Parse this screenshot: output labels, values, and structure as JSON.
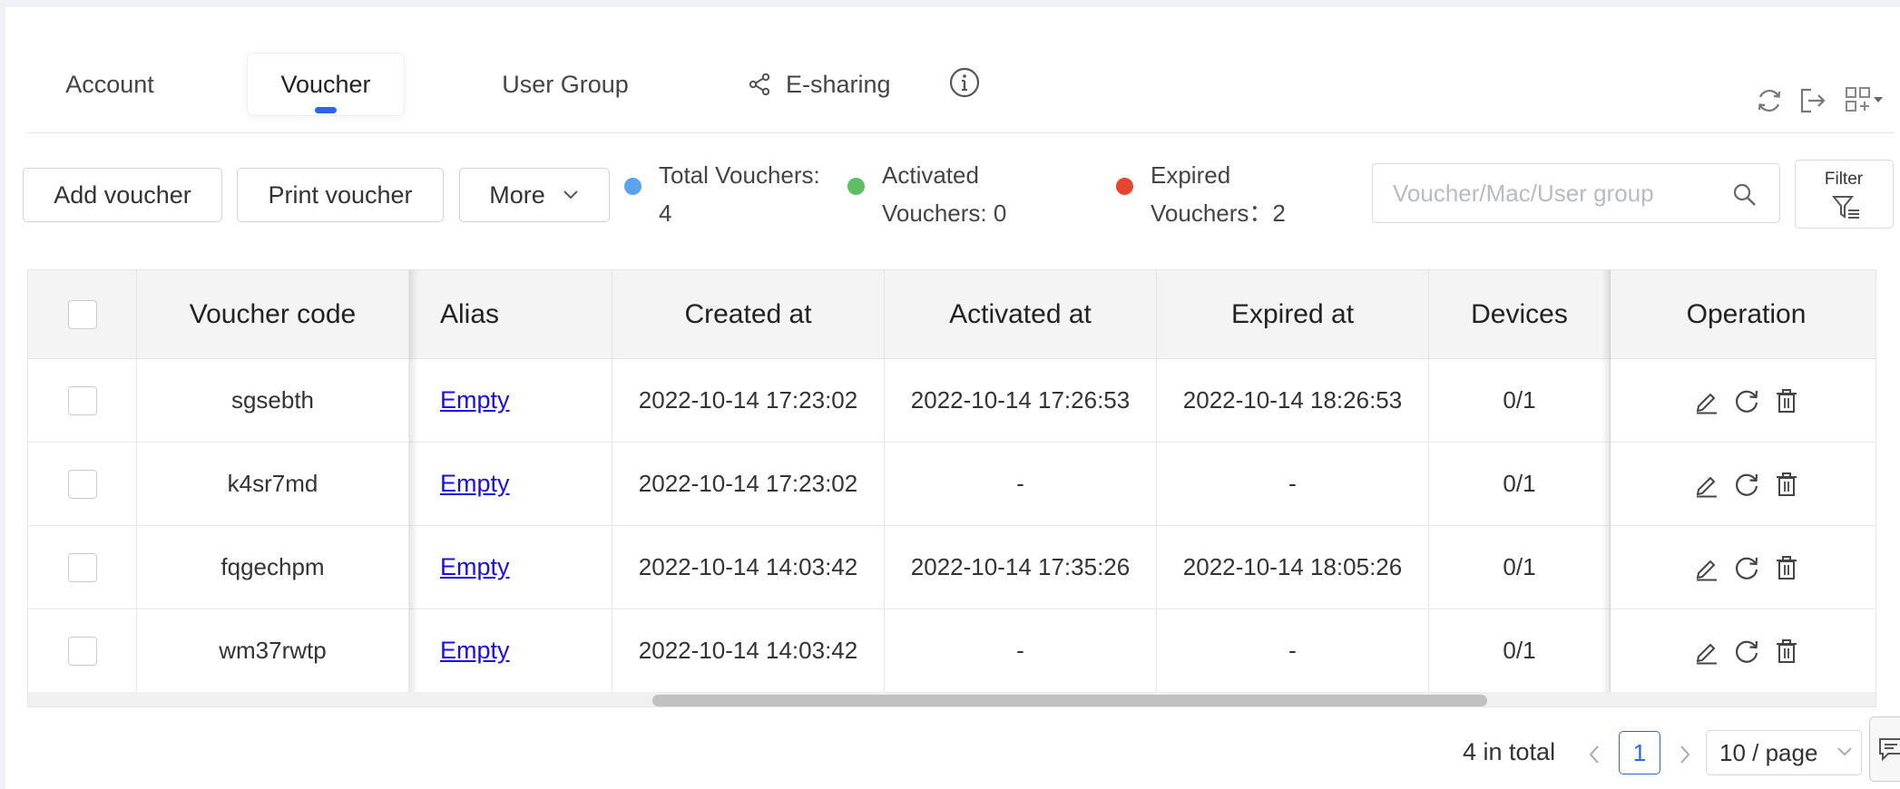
{
  "tabs": [
    {
      "label": "Account"
    },
    {
      "label": "Voucher"
    },
    {
      "label": "User Group"
    },
    {
      "label": "E-sharing"
    }
  ],
  "toolbar": {
    "add_voucher": "Add voucher",
    "print_voucher": "Print voucher",
    "more": "More"
  },
  "stats": {
    "total": {
      "line1": "Total Vouchers:",
      "line2": "4",
      "color": "#5aa3f0"
    },
    "activated": {
      "line1": "Activated",
      "line2": "Vouchers: 0",
      "color": "#5dbf62"
    },
    "expired": {
      "line1": "Expired",
      "line2": "Vouchers：2",
      "color": "#e8442d"
    }
  },
  "search": {
    "placeholder": "Voucher/Mac/User group"
  },
  "filter": {
    "label": "Filter"
  },
  "table": {
    "columns": [
      "Voucher code",
      "Alias",
      "Created at",
      "Activated at",
      "Expired at",
      "Devices",
      "Operation"
    ],
    "rows": [
      {
        "code": "sgsebth",
        "alias": "Empty",
        "created": "2022-10-14 17:23:02",
        "activated": "2022-10-14 17:26:53",
        "expired": "2022-10-14 18:26:53",
        "devices": "0/1"
      },
      {
        "code": "k4sr7md",
        "alias": "Empty",
        "created": "2022-10-14 17:23:02",
        "activated": "-",
        "expired": "-",
        "devices": "0/1"
      },
      {
        "code": "fqgechpm",
        "alias": "Empty",
        "created": "2022-10-14 14:03:42",
        "activated": "2022-10-14 17:35:26",
        "expired": "2022-10-14 18:05:26",
        "devices": "0/1"
      },
      {
        "code": "wm37rwtp",
        "alias": "Empty",
        "created": "2022-10-14 14:03:42",
        "activated": "-",
        "expired": "-",
        "devices": "0/1"
      }
    ]
  },
  "pagination": {
    "total": "4 in total",
    "current_page": "1",
    "page_size": "10 / page"
  },
  "colors": {
    "accent": "#2b66e8",
    "link": "#1a0dee"
  }
}
